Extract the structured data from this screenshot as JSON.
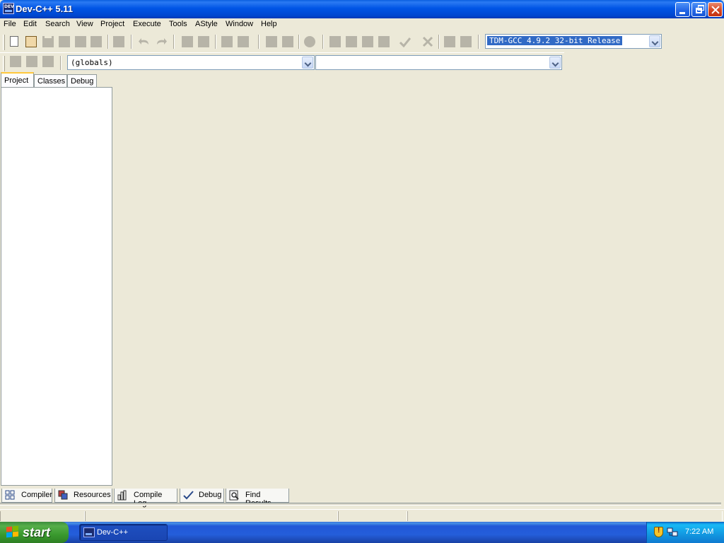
{
  "window": {
    "title": "Dev-C++ 5.11",
    "icon": "dev-cpp-app-icon"
  },
  "menu": [
    "File",
    "Edit",
    "Search",
    "View",
    "Project",
    "Execute",
    "Tools",
    "AStyle",
    "Window",
    "Help"
  ],
  "toolbar": {
    "compiler_select": "TDM-GCC 4.9.2 32-bit Release",
    "scope_select": "(globals)",
    "member_select": ""
  },
  "left_panel": {
    "tabs": [
      "Project",
      "Classes",
      "Debug"
    ],
    "active_tab": "Project"
  },
  "bottom_tabs": [
    {
      "label": "Compiler",
      "icon": "grid-icon"
    },
    {
      "label": "Resources",
      "icon": "resources-icon"
    },
    {
      "label": "Compile Log",
      "icon": "bar-chart-icon"
    },
    {
      "label": "Debug",
      "icon": "checkmark-icon"
    },
    {
      "label": "Find Results",
      "icon": "magnifier-icon"
    }
  ],
  "taskbar": {
    "start_label": "start",
    "task_label": "Dev-C++",
    "clock": "7:22 AM"
  },
  "colors": {
    "titlebar": "#0055e5",
    "selection": "#316ac5",
    "start_green": "#3a9a2e",
    "tray_blue": "#1190dc"
  }
}
